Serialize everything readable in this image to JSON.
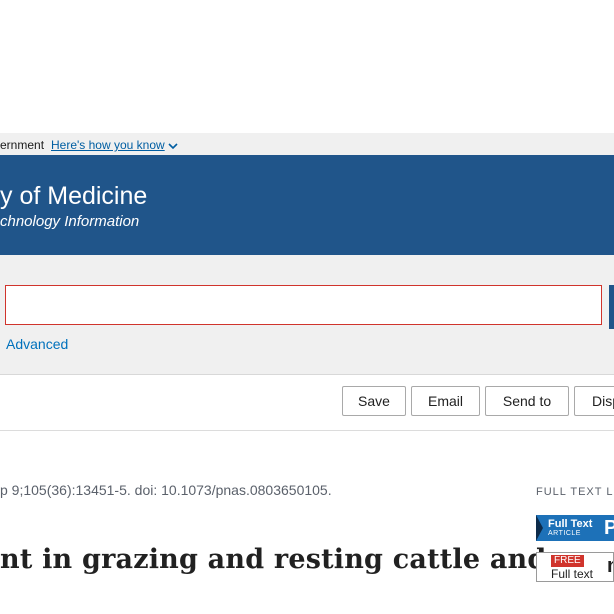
{
  "banner": {
    "gov_text": "ernment",
    "how_link": "Here's how you know"
  },
  "header": {
    "line1": "y of Medicine",
    "line2": "chnology Information"
  },
  "search": {
    "value": "",
    "placeholder": "",
    "advanced_label": "Advanced"
  },
  "actions": {
    "save": "Save",
    "email": "Email",
    "send_to": "Send to",
    "display": "Disp"
  },
  "article": {
    "citation": "p 9;105(36):13451-5. doi: 10.1073/pnas.0803650105.",
    "title": "nt in grazing and resting cattle and"
  },
  "sidebar": {
    "full_text_links_label": "FULL TEXT LI",
    "pnas_badge": {
      "line1": "Full Text",
      "line2": "ARTICLE",
      "logo": "P"
    },
    "free_badge": {
      "free": "FREE",
      "full_text": "Full text",
      "mark": "m"
    }
  },
  "colors": {
    "header_bg": "#20558a",
    "link": "#005ea2",
    "search_border": "#d0342c"
  }
}
